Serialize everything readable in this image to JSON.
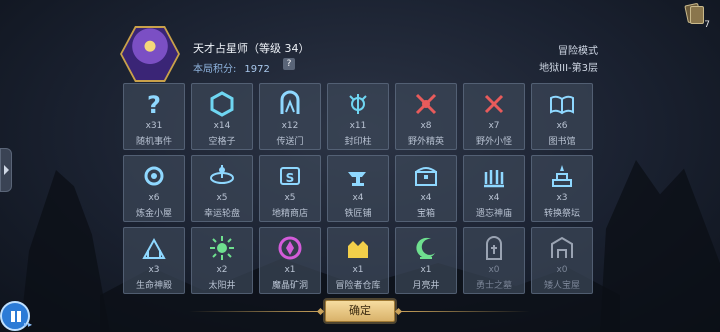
{
  "header": {
    "character_name": "天才占星师（等级 34）",
    "score_label": "本局积分:",
    "score_value": "1972",
    "help_label": "?",
    "mode": "冒险模式",
    "level": "地狱III-第3层"
  },
  "deck": {
    "count": "7"
  },
  "colors": {
    "accent": "#c9a25a",
    "grid_bg": "#3c4658",
    "icon_cyan": "#6fd6f2",
    "icon_red": "#e85b5b",
    "icon_purple": "#d35bd9",
    "icon_yellow": "#f2cf4a",
    "icon_green": "#6fe08f"
  },
  "cells": [
    {
      "count": "x31",
      "label": "随机事件",
      "icon": "question-icon",
      "color": "#8fd8ff"
    },
    {
      "count": "x14",
      "label": "空格子",
      "icon": "hexagon-icon",
      "color": "#6fd6f2"
    },
    {
      "count": "x12",
      "label": "传送门",
      "icon": "portal-icon",
      "color": "#8fd8ff"
    },
    {
      "count": "x11",
      "label": "封印柱",
      "icon": "seal-pillar-icon",
      "color": "#6fd6f2"
    },
    {
      "count": "x8",
      "label": "野外精英",
      "icon": "crossed-axes-icon",
      "color": "#e85b5b"
    },
    {
      "count": "x7",
      "label": "野外小怪",
      "icon": "crossed-swords-icon",
      "color": "#e85b5b"
    },
    {
      "count": "x6",
      "label": "图书馆",
      "icon": "book-icon",
      "color": "#8fd8ff"
    },
    {
      "count": "x6",
      "label": "炼金小屋",
      "icon": "alchemy-icon",
      "color": "#8fd8ff"
    },
    {
      "count": "x5",
      "label": "幸运轮盘",
      "icon": "wheel-icon",
      "color": "#8fd8ff"
    },
    {
      "count": "x5",
      "label": "地精商店",
      "icon": "shop-icon",
      "color": "#8fd8ff"
    },
    {
      "count": "x4",
      "label": "铁匠铺",
      "icon": "anvil-icon",
      "color": "#8fd8ff"
    },
    {
      "count": "x4",
      "label": "宝箱",
      "icon": "chest-icon",
      "color": "#8fd8ff"
    },
    {
      "count": "x4",
      "label": "遗忘神庙",
      "icon": "temple-icon",
      "color": "#8fd8ff"
    },
    {
      "count": "x3",
      "label": "转换祭坛",
      "icon": "altar-icon",
      "color": "#8fd8ff"
    },
    {
      "count": "x3",
      "label": "生命神殿",
      "icon": "life-shrine-icon",
      "color": "#8fd8ff"
    },
    {
      "count": "x2",
      "label": "太阳井",
      "icon": "sun-icon",
      "color": "#6fe08f"
    },
    {
      "count": "x1",
      "label": "魔晶矿洞",
      "icon": "crystal-mine-icon",
      "color": "#d35bd9"
    },
    {
      "count": "x1",
      "label": "冒险者仓库",
      "icon": "warehouse-icon",
      "color": "#f2cf4a"
    },
    {
      "count": "x1",
      "label": "月亮井",
      "icon": "moon-icon",
      "color": "#6fe08f"
    },
    {
      "count": "x0",
      "label": "勇士之墓",
      "icon": "tomb-icon",
      "color": "#9aa3b2"
    },
    {
      "count": "x0",
      "label": "矮人宝屋",
      "icon": "dwarf-vault-icon",
      "color": "#9aa3b2"
    }
  ],
  "confirm_label": "确定"
}
